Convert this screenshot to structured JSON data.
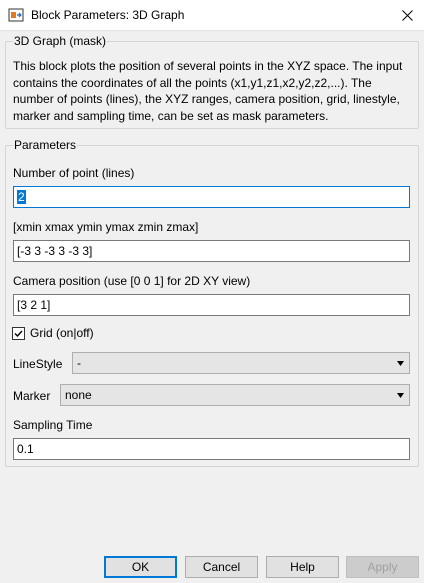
{
  "window": {
    "title": "Block Parameters: 3D Graph",
    "icon": "block-parameters-icon",
    "close_icon": "close-icon"
  },
  "mask_group": {
    "legend": "3D Graph (mask)",
    "description": "This block plots the position of several points in the XYZ space. The input contains the coordinates of all the points (x1,y1,z1,x2,y2,z2,...). The number of points (lines), the XYZ ranges, camera position, grid, linestyle, marker and sampling time, can be set as mask parameters."
  },
  "params_group": {
    "legend": "Parameters",
    "num_points": {
      "label": "Number of point (lines)",
      "value": "2"
    },
    "ranges": {
      "label": "[xmin xmax  ymin ymax zmin zmax]",
      "value": "[-3 3 -3 3 -3 3]"
    },
    "camera": {
      "label": "Camera position (use [0 0 1] for 2D XY view)",
      "value": "[3 2 1]"
    },
    "grid": {
      "label": "Grid (on|off)",
      "checked": true
    },
    "linestyle": {
      "label": "LineStyle",
      "value": "-"
    },
    "marker": {
      "label": "Marker",
      "value": "none"
    },
    "sampling": {
      "label": "Sampling Time",
      "value": "0.1"
    }
  },
  "buttons": {
    "ok": "OK",
    "cancel": "Cancel",
    "help": "Help",
    "apply": "Apply"
  }
}
